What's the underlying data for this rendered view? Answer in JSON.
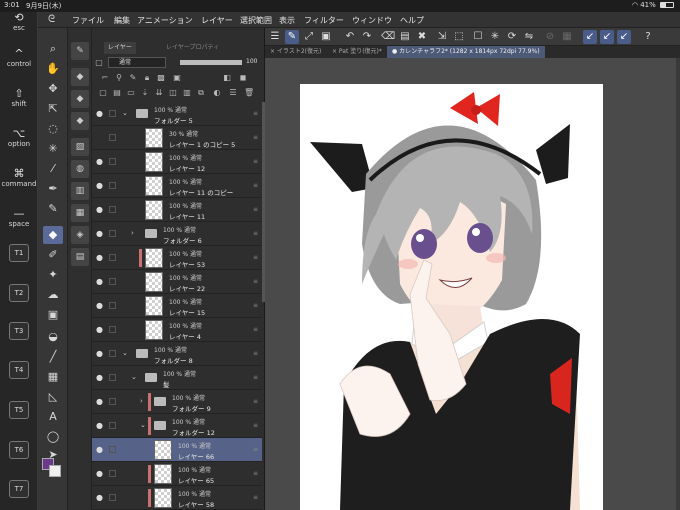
{
  "status": {
    "time": "3:01",
    "date": "9月9日(木)",
    "battery": "41%"
  },
  "edge_keys": [
    {
      "glyph": "⟲",
      "label": "esc"
    },
    {
      "glyph": "^",
      "label": "control"
    },
    {
      "glyph": "⇧",
      "label": "shift"
    },
    {
      "glyph": "⌥",
      "label": "option"
    },
    {
      "glyph": "⌘",
      "label": "command"
    },
    {
      "glyph": "—",
      "label": "space"
    }
  ],
  "t_keys": [
    "T1",
    "T2",
    "T3",
    "T4",
    "T5",
    "T6",
    "T7"
  ],
  "menu": [
    "ファイル",
    "編集",
    "アニメーション",
    "レイヤー",
    "選択範囲",
    "表示",
    "フィルター",
    "ウィンドウ",
    "ヘルプ"
  ],
  "tabs": [
    {
      "label": "× イラスト2(復元)"
    },
    {
      "label": "× Pat 塗り(復元)*"
    },
    {
      "label": "● カレンチャラフ2* (1282 x 1814px 72dpi 77.9%)"
    }
  ],
  "layer_panel": {
    "tab_layer": "レイヤー",
    "tab_property": "レイヤープロパティ",
    "blend_mode": "通常",
    "opacity": "100",
    "opacity_fraction": 1.0,
    "layers": [
      {
        "l1": "100 % 通常",
        "l2": "フォルダー 5",
        "type": "folder",
        "indent": 0,
        "eye": true,
        "expanded": true,
        "red": false
      },
      {
        "l1": "30 % 通常",
        "l2": "レイヤー 1 のコピー 5",
        "type": "layer",
        "indent": 1,
        "eye": false,
        "red": false
      },
      {
        "l1": "100 % 通常",
        "l2": "レイヤー 12",
        "type": "layer",
        "indent": 1,
        "eye": true,
        "red": false
      },
      {
        "l1": "100 % 通常",
        "l2": "レイヤー 11 のコピー",
        "type": "layer",
        "indent": 1,
        "eye": true,
        "red": false
      },
      {
        "l1": "100 % 通常",
        "l2": "レイヤー 11",
        "type": "layer",
        "indent": 1,
        "eye": true,
        "red": false
      },
      {
        "l1": "100 % 通常",
        "l2": "フォルダー 6",
        "type": "folder",
        "indent": 1,
        "eye": true,
        "expanded": false,
        "red": false
      },
      {
        "l1": "100 % 通常",
        "l2": "レイヤー 53",
        "type": "layer",
        "indent": 1,
        "eye": true,
        "red": true
      },
      {
        "l1": "100 % 通常",
        "l2": "レイヤー 22",
        "type": "layer",
        "indent": 1,
        "eye": true,
        "red": false
      },
      {
        "l1": "100 % 通常",
        "l2": "レイヤー 15",
        "type": "layer",
        "indent": 1,
        "eye": true,
        "red": false
      },
      {
        "l1": "100 % 通常",
        "l2": "レイヤー 4",
        "type": "layer",
        "indent": 1,
        "eye": true,
        "red": false
      },
      {
        "l1": "100 % 通常",
        "l2": "フォルダー 8",
        "type": "folder",
        "indent": 0,
        "eye": true,
        "expanded": true,
        "red": false
      },
      {
        "l1": "100 % 通常",
        "l2": "髪",
        "type": "folder",
        "indent": 1,
        "eye": true,
        "expanded": true,
        "red": false
      },
      {
        "l1": "100 % 通常",
        "l2": "フォルダー 9",
        "type": "folder",
        "indent": 2,
        "eye": true,
        "expanded": false,
        "red": true
      },
      {
        "l1": "100 % 通常",
        "l2": "フォルダー 12",
        "type": "folder",
        "indent": 2,
        "eye": true,
        "expanded": true,
        "red": true
      },
      {
        "l1": "100 % 通常",
        "l2": "レイヤー 66",
        "type": "layer",
        "indent": 2,
        "eye": true,
        "red": false,
        "selected": true
      },
      {
        "l1": "100 % 通常",
        "l2": "レイヤー 65",
        "type": "layer",
        "indent": 2,
        "eye": true,
        "red": true
      },
      {
        "l1": "100 % 通常",
        "l2": "レイヤー 58",
        "type": "layer",
        "indent": 2,
        "eye": true,
        "red": true
      },
      {
        "l1": "100 % 通常",
        "l2": "",
        "type": "layer",
        "indent": 2,
        "eye": true,
        "red": true
      }
    ]
  },
  "colors": {
    "main": "#6a3a8c",
    "sub": "#f0f0f0",
    "accent": "#566287"
  }
}
